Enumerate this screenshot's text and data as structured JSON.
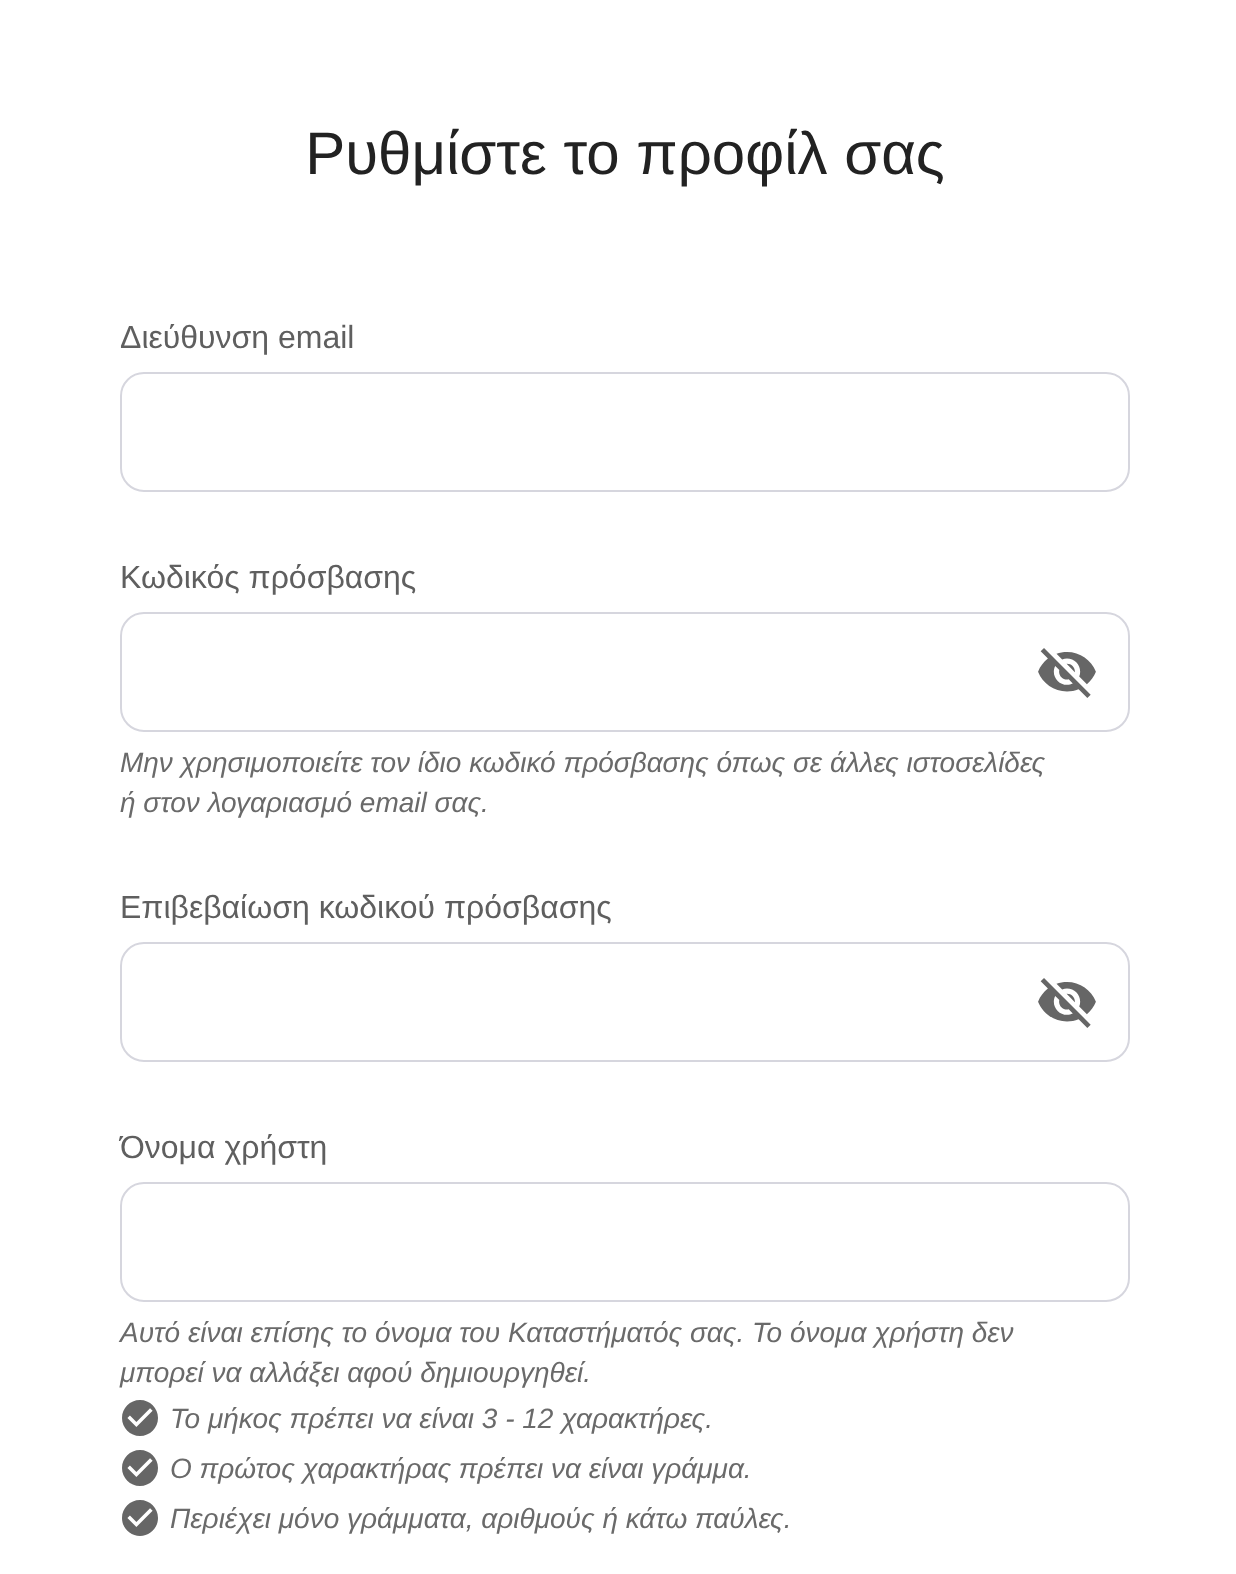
{
  "title": "Ρυθμίστε το προφίλ σας",
  "fields": [
    {
      "kind": "text",
      "label": "Διεύθυνση email"
    },
    {
      "kind": "password",
      "label": "Κωδικός πρόσβασης",
      "revealed": false,
      "hint": "Μην χρησιμοποιείτε τον ίδιο κωδικό πρόσβασης όπως σε άλλες ιστοσελίδες ή στον λογαριασμό email σας."
    },
    {
      "kind": "password",
      "label": "Επιβεβαίωση κωδικού πρόσβασης",
      "revealed": false
    },
    {
      "kind": "text",
      "label": "Όνομα χρήστη",
      "hint": "Αυτό είναι επίσης το όνομα του Καταστήματός σας. Το όνομα χρήστη δεν μπορεί να αλλάξει αφού δημιουργηθεί.",
      "rules": [
        "Το μήκος πρέπει να είναι 3 - 12 χαρακτήρες.",
        "Ο πρώτος χαρακτήρας πρέπει να είναι γράμμα.",
        "Περιέχει μόνο γράμματα, αριθμούς ή κάτω παύλες."
      ]
    }
  ]
}
